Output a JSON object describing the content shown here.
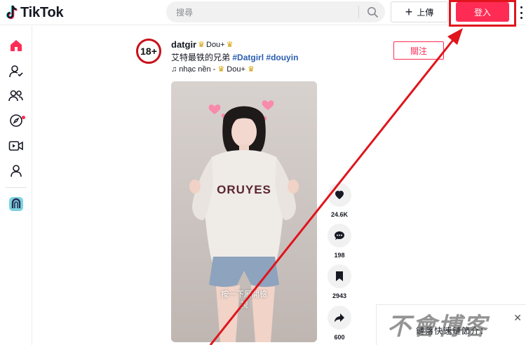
{
  "app": {
    "logo_text": "TikTok"
  },
  "header": {
    "search_placeholder": "搜尋",
    "upload_label": "上傳",
    "login_label": "登入"
  },
  "sidebar": {
    "items": [
      "home-icon",
      "following-icon",
      "friends-icon",
      "explore-icon",
      "live-icon",
      "profile-icon",
      "app-icon"
    ]
  },
  "post": {
    "age_badge": "18+",
    "author_name": "datgir",
    "author_sub": "Dou+",
    "caption_text": "艾特最铁的兄弟",
    "hashtag_1": "#Datgirl",
    "hashtag_2": "#douyin",
    "music_text": "♫ nhạc nền -",
    "music_sub": "Dou+",
    "follow_label": "關注",
    "video_hint_line1": "按一下展開檢",
    "video_hint_line2": "視"
  },
  "actions": {
    "likes": "24.6K",
    "comments": "198",
    "saves": "2943",
    "shares": "600"
  },
  "overlay": {
    "bottom_text": "鏈落快速鏈節介：",
    "watermark": "不會博客",
    "accent_color": "#fe2c55",
    "annotation_color": "#e0141c"
  }
}
